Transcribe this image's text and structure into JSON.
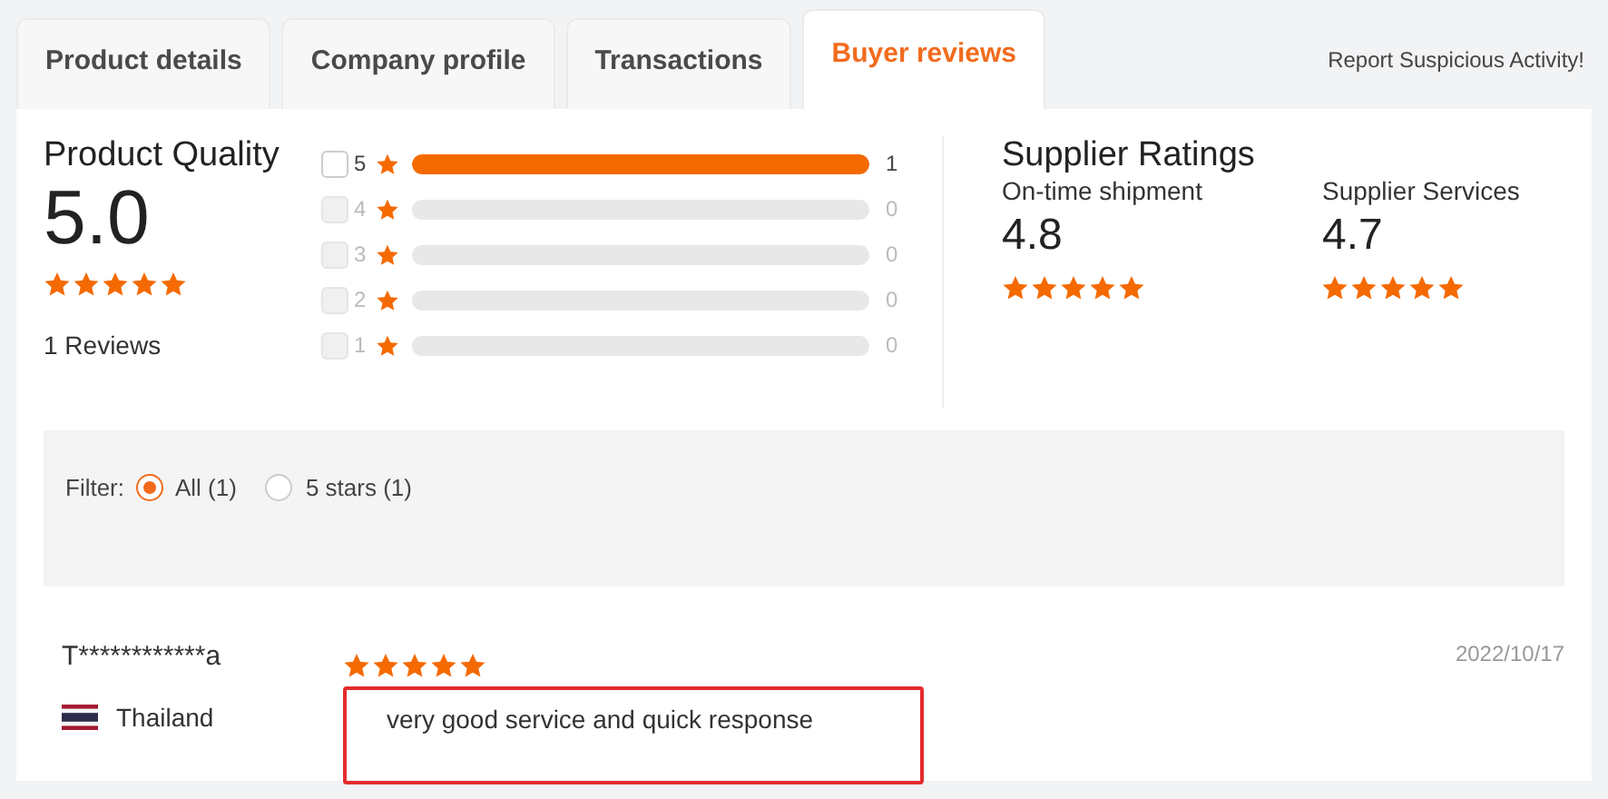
{
  "tabs": [
    {
      "label": "Product details",
      "selected": false
    },
    {
      "label": "Company profile",
      "selected": false
    },
    {
      "label": "Transactions",
      "selected": false
    },
    {
      "label": "Buyer reviews",
      "selected": true
    }
  ],
  "report_link": "Report Suspicious Activity!",
  "product_quality": {
    "title": "Product Quality",
    "score": "5.0",
    "stars": 5,
    "reviews": "1 Reviews"
  },
  "breakdown": [
    {
      "star": "5",
      "count": "1",
      "level": 1,
      "disabled": false,
      "checked": false
    },
    {
      "star": "4",
      "count": "0",
      "level": 0,
      "disabled": true,
      "checked": false
    },
    {
      "star": "3",
      "count": "0",
      "level": 0,
      "disabled": true,
      "checked": false
    },
    {
      "star": "2",
      "count": "0",
      "level": 0,
      "disabled": true,
      "checked": false
    },
    {
      "star": "1",
      "count": "0",
      "level": 0,
      "disabled": true,
      "checked": false
    }
  ],
  "supplier_ratings": {
    "title": "Supplier Ratings",
    "items": [
      {
        "label": "On-time shipment",
        "score": "4.8",
        "stars": 5
      },
      {
        "label": "Supplier Services",
        "score": "4.7",
        "stars": 5
      }
    ]
  },
  "filter": {
    "label": "Filter:",
    "options": [
      {
        "label": "All (1)",
        "selected": true
      },
      {
        "label": "5 stars (1)",
        "selected": false
      }
    ]
  },
  "reviews": [
    {
      "user": "T************a",
      "country": "Thailand",
      "stars": 5,
      "date": "2022/10/17",
      "comment": "very good service and quick response",
      "highlighted": true
    }
  ]
}
